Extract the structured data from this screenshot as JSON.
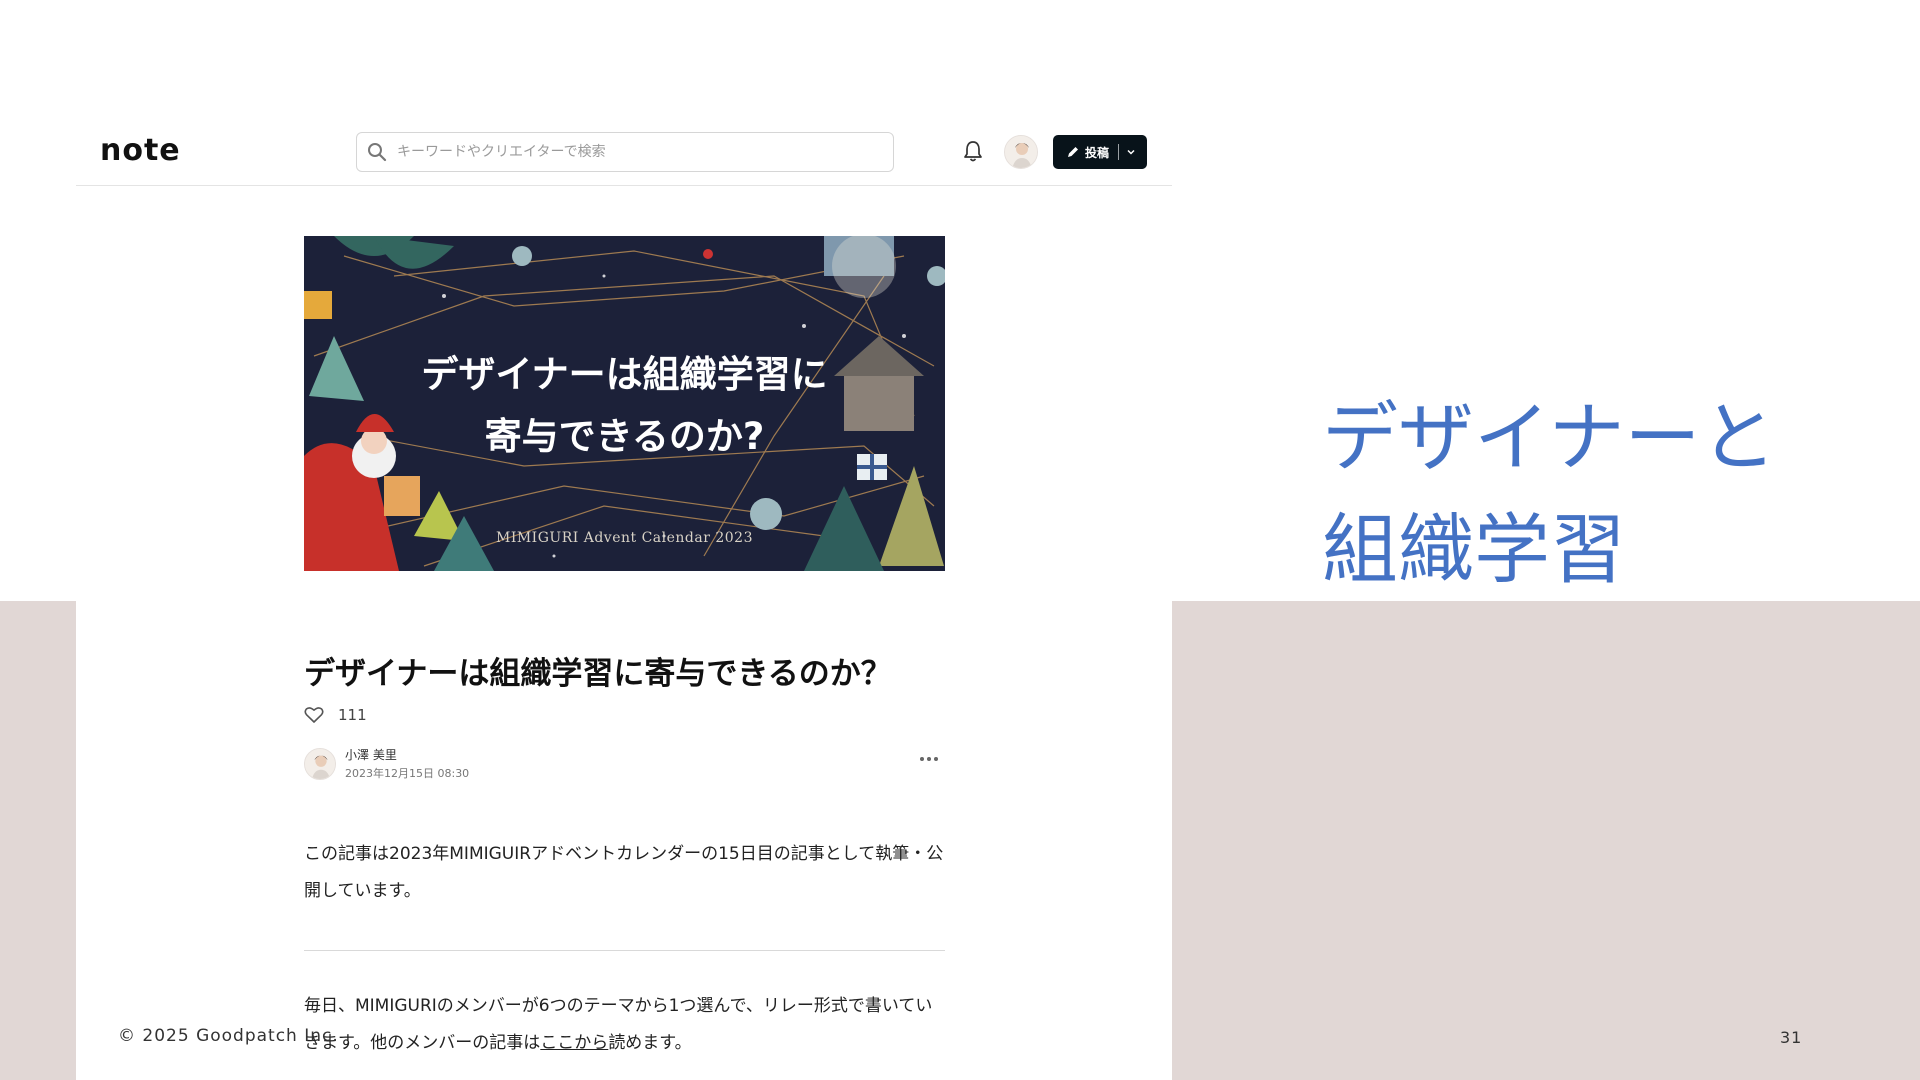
{
  "slide": {
    "heading_line1": "デザイナーと",
    "heading_line2": "組織学習",
    "copyright": "© 2025 Goodpatch Inc.",
    "page_number": "31",
    "colors": {
      "heading": "#4472c4",
      "band": "#e1d7d5"
    }
  },
  "note": {
    "logo": "note",
    "search": {
      "placeholder": "キーワードやクリエイターで検索",
      "value": ""
    },
    "post_button_label": "投稿",
    "icons": [
      "search-icon",
      "bell-icon",
      "pen-icon",
      "chevron-down-icon",
      "heart-icon",
      "more-icon"
    ]
  },
  "article": {
    "hero": {
      "title_line1": "デザイナーは組織学習に",
      "title_line2": "寄与できるのか?",
      "caption": "MIMIGURI  Advent Calendar 2023"
    },
    "title": "デザイナーは組織学習に寄与できるのか？",
    "likes": "111",
    "author": "小澤 美里",
    "date": "2023年12月15日 08:30",
    "para1": "この記事は2023年MIMIGUIRアドベントカレンダーの15日目の記事として執筆・公開しています。",
    "para2_before": "毎日、MIMIGURIのメンバーが6つのテーマから1つ選んで、リレー形式で書いていきます。他のメンバーの記事は",
    "para2_link": "ここから",
    "para2_after": "読めます。"
  }
}
